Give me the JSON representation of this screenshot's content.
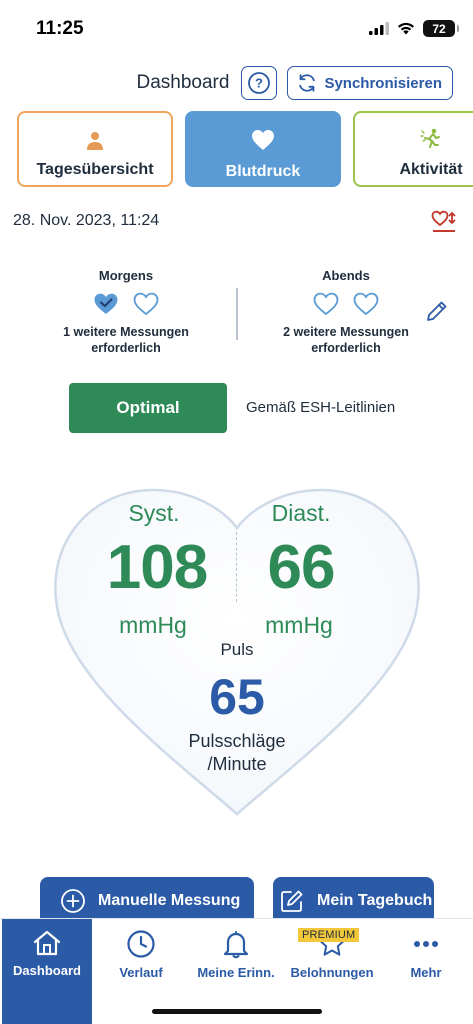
{
  "status_bar": {
    "time": "11:25",
    "battery": "72"
  },
  "header": {
    "title": "Dashboard",
    "help": "?",
    "sync_label": "Synchronisieren"
  },
  "tabs": [
    {
      "label": "Tagesübersicht",
      "icon": "person-icon",
      "color": "#f0a55a"
    },
    {
      "label": "Blutdruck",
      "icon": "heart-icon",
      "color": "#5a9bd5"
    },
    {
      "label": "Aktivität",
      "icon": "running-person-icon",
      "color": "#9ac44a"
    }
  ],
  "date": "28. Nov. 2023, 11:24",
  "measurements": {
    "morning": {
      "title": "Morgens",
      "done": 1,
      "total": 2,
      "note_line1": "1 weitere Messungen",
      "note_line2": "erforderlich"
    },
    "evening": {
      "title": "Abends",
      "done": 0,
      "total": 2,
      "note_line1": "2 weitere Messungen",
      "note_line2": "erforderlich"
    }
  },
  "status": {
    "label": "Optimal",
    "color": "#2e8a57",
    "guideline": "Gemäß ESH-Leitlinien"
  },
  "reading": {
    "syst_label": "Syst.",
    "syst_value": "108",
    "syst_unit": "mmHg",
    "diast_label": "Diast.",
    "diast_value": "66",
    "diast_unit": "mmHg",
    "pulse_label": "Puls",
    "pulse_value": "65",
    "pulse_unit_line1": "Pulsschläge",
    "pulse_unit_line2": "/Minute"
  },
  "actions": {
    "manual": "Manuelle Messung",
    "diary": "Mein Tagebuch"
  },
  "nav": {
    "dashboard": "Dashboard",
    "history": "Verlauf",
    "reminders": "Meine Erinn.",
    "rewards": "Belohnungen",
    "rewards_badge": "PREMIUM",
    "more": "Mehr"
  },
  "colors": {
    "accent": "#2b5aa6",
    "green": "#2e8a57",
    "light_blue": "#5a9bd5"
  }
}
